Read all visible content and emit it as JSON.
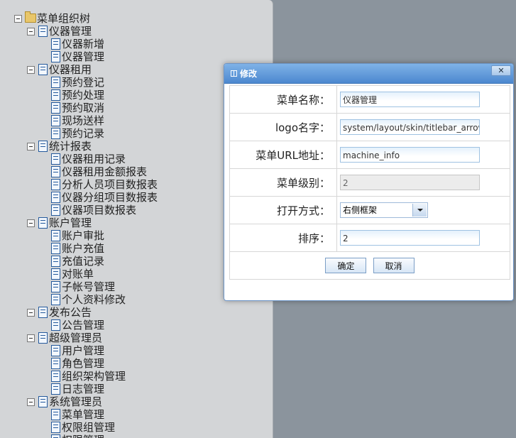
{
  "tree": {
    "root": "菜单组织树",
    "groups": [
      {
        "label": "仪器管理",
        "items": [
          "仪器新增",
          "仪器管理"
        ]
      },
      {
        "label": "仪器租用",
        "items": [
          "预约登记",
          "预约处理",
          "预约取消",
          "现场送样",
          "预约记录"
        ]
      },
      {
        "label": "统计报表",
        "items": [
          "仪器租用记录",
          "仪器租用金额报表",
          "分析人员项目数报表",
          "仪器分组项目数报表",
          "仪器项目数报表"
        ]
      },
      {
        "label": "账户管理",
        "items": [
          "账户审批",
          "账户充值",
          "充值记录",
          "对账单",
          "子帐号管理",
          "个人资料修改"
        ]
      },
      {
        "label": "发布公告",
        "items": [
          "公告管理"
        ]
      },
      {
        "label": "超级管理员",
        "items": [
          "用户管理",
          "角色管理",
          "组织架构管理",
          "日志管理"
        ]
      },
      {
        "label": "系统管理员",
        "items": [
          "菜单管理",
          "权限组管理",
          "权限管理"
        ]
      }
    ]
  },
  "dialog": {
    "title": "修改",
    "close_label": "✕",
    "fields": [
      {
        "label": "菜单名称：",
        "value": "仪器管理",
        "type": "text"
      },
      {
        "label": "logo名字：",
        "value": "system/layout/skin/titlebar_arrow.g",
        "type": "text"
      },
      {
        "label": "菜单URL地址：",
        "value": "machine_info",
        "type": "text"
      },
      {
        "label": "菜单级别：",
        "value": "2",
        "type": "disabled"
      },
      {
        "label": "打开方式：",
        "value": "右侧框架",
        "type": "select"
      },
      {
        "label": "排序：",
        "value": "2",
        "type": "text"
      }
    ],
    "confirm_label": "确定",
    "cancel_label": "取消"
  }
}
